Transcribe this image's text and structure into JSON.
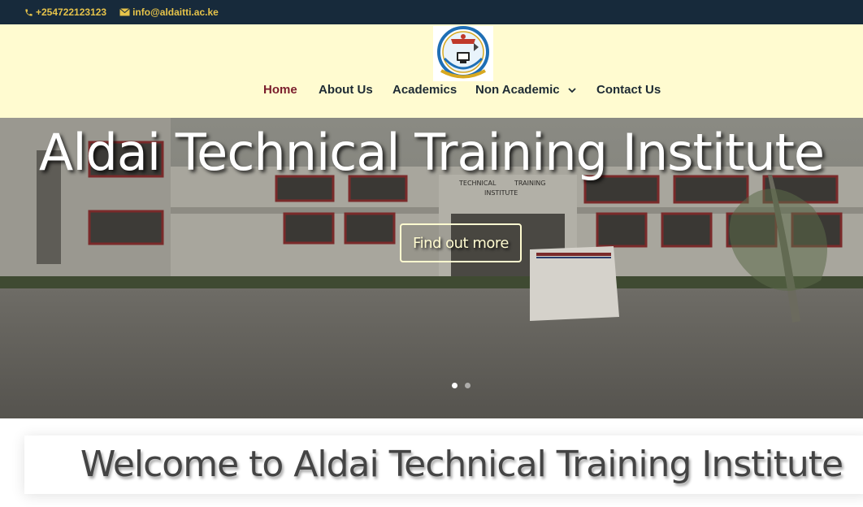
{
  "topbar": {
    "phone": "+254722123123",
    "email": "info@aldaitti.ac.ke"
  },
  "nav": {
    "items": [
      {
        "label": "Home",
        "active": true
      },
      {
        "label": "About Us"
      },
      {
        "label": "Academics"
      },
      {
        "label": "Non Academic",
        "has_dropdown": true
      },
      {
        "label": "Contact Us"
      }
    ]
  },
  "hero": {
    "title": "Aldai Technical Training Institute",
    "button": "Find out more",
    "building_sign": [
      "TECHNICAL",
      "TRAINING",
      "INSTITUTE"
    ],
    "slides_count": 2,
    "active_slide": 1
  },
  "welcome": {
    "title": "Welcome to Aldai Technical Training Institute"
  },
  "colors": {
    "topbar_bg": "#172a3b",
    "topbar_text": "#e6c34a",
    "header_bg": "#fffbd0",
    "nav_active": "#7a1d2c"
  }
}
